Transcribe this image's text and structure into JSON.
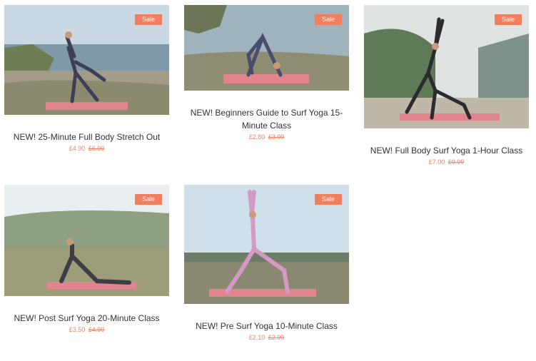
{
  "products": [
    {
      "title": "NEW! 25-Minute Full Body Stretch Out",
      "badge": "Sale",
      "price": "£4.90",
      "compare_price": "£6.99"
    },
    {
      "title": "NEW! Beginners Guide to Surf Yoga 15-Minute Class",
      "badge": "Sale",
      "price": "£2.80",
      "compare_price": "£3.99"
    },
    {
      "title": "NEW! Full Body Surf Yoga 1-Hour Class",
      "badge": "Sale",
      "price": "£7.00",
      "compare_price": "£9.99"
    },
    {
      "title": "NEW! Post Surf Yoga 20-Minute Class",
      "badge": "Sale",
      "price": "£3.50",
      "compare_price": "£4.99"
    },
    {
      "title": "NEW! Pre Surf Yoga 10-Minute Class",
      "badge": "Sale",
      "price": "£2.10",
      "compare_price": "£2.99"
    }
  ],
  "colors": {
    "sale_badge": "#f07e61",
    "price": "#e8856b",
    "mat": "#e0848e"
  }
}
